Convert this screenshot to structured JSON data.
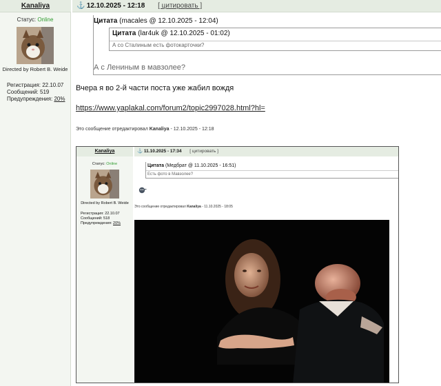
{
  "header": {
    "username": "Kanaliya",
    "date": "12.10.2025 - 12:18",
    "cite_label": "[ цитировать ]"
  },
  "user": {
    "status_label": "Статус:",
    "status_value": "Online",
    "signature": "Directed by Robert B. Weide",
    "registration": "Регистрация: 22.10.07",
    "messages": "Сообщений: 519",
    "warnings_label": "Предупреждения:",
    "warnings_value": "20%"
  },
  "post": {
    "quote_outer": {
      "label": "Цитата",
      "author": "(macales @ 12.10.2025 - 12:04)",
      "text": "А с Лениным в мавзолее?"
    },
    "quote_inner": {
      "label": "Цитата",
      "author": "(lar4uk @ 12.10.2025 - 01:02)",
      "text": "А со Сталиным есть фотокарточки?"
    },
    "text": "Вчера я во 2-й части поста уже жабил вождя",
    "link": "https://www.yaplakal.com/forum2/topic2997028.html?hl=",
    "edit_prefix": "Это сообщение отредактировал",
    "edit_user": "Kanaliya",
    "edit_suffix": "- 12.10.2025 - 12:18"
  },
  "embed": {
    "username": "Kanaliya",
    "date": "11.10.2025 - 17:34",
    "cite_label": "[ цитировать ]",
    "status_label": "Статус:",
    "status_value": "Online",
    "signature": "Directed by Robert B. Weide",
    "registration": "Регистрация: 22.10.07",
    "messages": "Сообщений: 518",
    "warnings_label": "Предупреждения:",
    "warnings_value": "20%",
    "quote_label": "Цитата",
    "quote_author": "(Медбрат @ 11.10.2025 - 16:51)",
    "quote_text": "Есть фото в Мавзолее?",
    "edit_prefix": "Это сообщение отредактировал",
    "edit_user": "Kanaliya",
    "edit_suffix": "- 11.10.2025 - 18:05"
  },
  "colors": {
    "header_bg": "#e5ece2",
    "online": "#2e9b2e"
  }
}
